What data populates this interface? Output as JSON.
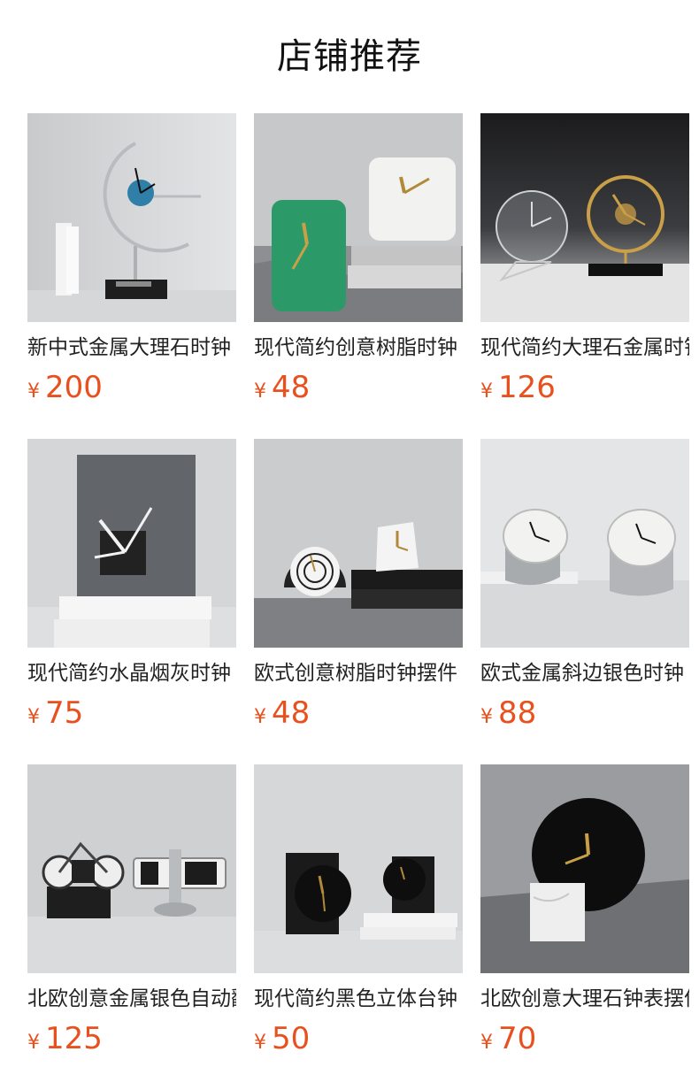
{
  "page_title": "店铺推荐",
  "currency_symbol": "¥",
  "products": [
    {
      "name": "新中式金属大理石时钟",
      "price": "200",
      "image": "silver-arc-clock-photo"
    },
    {
      "name": "现代简约创意树脂时钟",
      "price": "48",
      "image": "resin-square-clocks-photo"
    },
    {
      "name": "现代简约大理石金属时钟",
      "price": "126",
      "image": "gold-ring-clocks-photo"
    },
    {
      "name": "现代简约水晶烟灰时钟",
      "price": "75",
      "image": "smoke-crystal-clock-photo"
    },
    {
      "name": "欧式创意树脂时钟摆件",
      "price": "48",
      "image": "round-rings-clock-photo"
    },
    {
      "name": "欧式金属斜边银色时钟",
      "price": "88",
      "image": "slanted-silver-clocks-photo"
    },
    {
      "name": "北欧创意金属银色自动翻页钟",
      "price": "125",
      "image": "flip-clock-bike-photo"
    },
    {
      "name": "现代简约黑色立体台钟",
      "price": "50",
      "image": "black-block-clocks-photo"
    },
    {
      "name": "北欧创意大理石钟表摆件",
      "price": "70",
      "image": "black-disc-marble-clock-photo"
    }
  ]
}
